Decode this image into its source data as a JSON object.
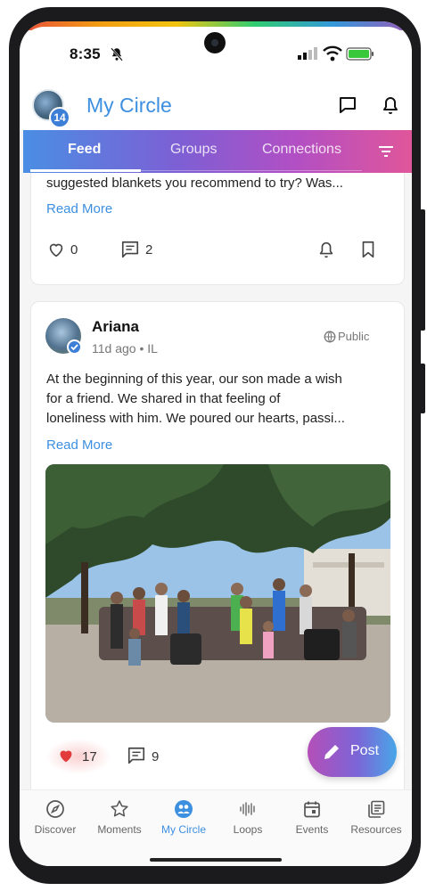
{
  "status_bar": {
    "time": "8:35"
  },
  "header": {
    "title": "My Circle",
    "notification_count": "14"
  },
  "tabs": [
    {
      "label": "Feed",
      "active": true
    },
    {
      "label": "Groups",
      "active": false
    },
    {
      "label": "Connections",
      "active": false
    }
  ],
  "post1": {
    "text_tail": "suggested blankets you recommend to try? Was...",
    "read_more": "Read More",
    "likes": "0",
    "comments": "2"
  },
  "post2": {
    "author": "Ariana",
    "meta": "11d ago • IL",
    "visibility": "Public",
    "text_lines": [
      "At the beginning of this year, our son made a wish",
      "for a friend. We shared in that feeling of",
      "loneliness with him. We poured our hearts, passi..."
    ],
    "read_more": "Read More",
    "likes": "17",
    "comments": "9",
    "liked": true
  },
  "fab": {
    "label": "Post"
  },
  "bottom_nav": [
    {
      "label": "Discover",
      "icon": "compass-icon",
      "active": false
    },
    {
      "label": "Moments",
      "icon": "star-icon",
      "active": false
    },
    {
      "label": "My Circle",
      "icon": "circle-icon",
      "active": true
    },
    {
      "label": "Loops",
      "icon": "waveform-icon",
      "active": false
    },
    {
      "label": "Events",
      "icon": "calendar-icon",
      "active": false
    },
    {
      "label": "Resources",
      "icon": "library-icon",
      "active": false
    }
  ],
  "colors": {
    "accent": "#3d8fe0",
    "like": "#e23b3b",
    "badge": "#3d7fd6"
  }
}
